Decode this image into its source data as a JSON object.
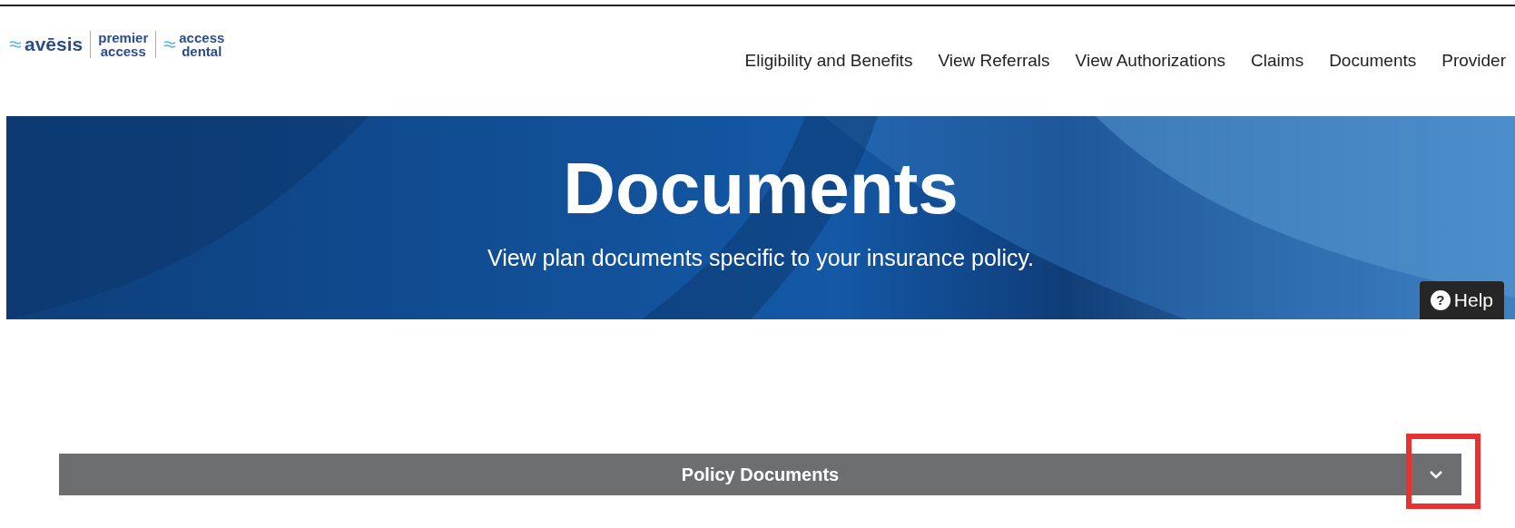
{
  "logo": {
    "brands": [
      "avēsis",
      "premier\naccess",
      "access\ndental"
    ]
  },
  "nav": {
    "items": [
      "Eligibility and Benefits",
      "View Referrals",
      "View Authorizations",
      "Claims",
      "Documents",
      "Provider"
    ]
  },
  "banner": {
    "title": "Documents",
    "subtitle": "View plan documents specific to your insurance policy.",
    "help_button": {
      "label": "Help",
      "icon_glyph": "?"
    }
  },
  "accordion": {
    "title": "Policy Documents",
    "expanded": false,
    "highlighted": true
  }
}
